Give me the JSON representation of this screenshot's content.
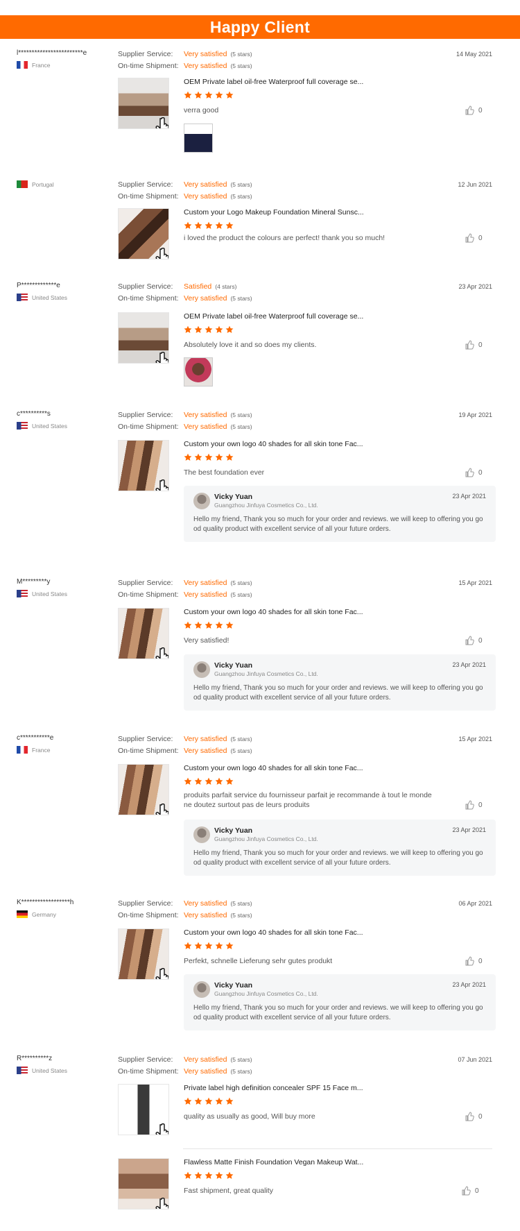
{
  "banner": {
    "title": "Happy Client"
  },
  "labels": {
    "supplier": "Supplier Service:",
    "shipment": "On-time Shipment:"
  },
  "reply": {
    "name": "Vicky Yuan",
    "company": "Guangzhou Jinfuya Cosmetics Co., Ltd.",
    "message": "Hello my friend, Thank you so much for your order and reviews. we will keep to offering you go od quality product with excellent service of all your future orders."
  },
  "colors": {
    "accent": "#ff6a00"
  },
  "reviews": [
    {
      "buyer": "l************************e",
      "country": "France",
      "date": "14 May 2021",
      "supplier": "Very satisfied",
      "supplier_stars": "(5 stars)",
      "shipment": "Very satisfied",
      "shipment_stars": "(5 stars)",
      "product": "OEM Private label oil-free Waterproof full coverage se...",
      "text": "verra good",
      "likes": "0",
      "rating": 5
    },
    {
      "buyer": "",
      "country": "Portugal",
      "date": "12 Jun 2021",
      "supplier": "Very satisfied",
      "supplier_stars": "(5 stars)",
      "shipment": "Very satisfied",
      "shipment_stars": "(5 stars)",
      "product": "Custom your Logo Makeup Foundation Mineral Sunsc...",
      "text": "i loved the product the colours are perfect! thank you so much!",
      "likes": "0",
      "rating": 5
    },
    {
      "buyer": "P*************e",
      "country": "United States",
      "date": "23 Apr 2021",
      "supplier": "Satisfied",
      "supplier_stars": "(4 stars)",
      "shipment": "Very satisfied",
      "shipment_stars": "(5 stars)",
      "product": "OEM Private label oil-free Waterproof full coverage se...",
      "text": "Absolutely love it and so does my clients.",
      "likes": "0",
      "rating": 5
    },
    {
      "buyer": "c**********s",
      "country": "United States",
      "date": "19 Apr 2021",
      "supplier": "Very satisfied",
      "supplier_stars": "(5 stars)",
      "shipment": "Very satisfied",
      "shipment_stars": "(5 stars)",
      "product": "Custom your own logo 40 shades for all skin tone Fac...",
      "text": "The best foundation ever",
      "likes": "0",
      "rating": 5,
      "reply_date": "23 Apr 2021"
    },
    {
      "buyer": "M*********y",
      "country": "United States",
      "date": "15 Apr 2021",
      "supplier": "Very satisfied",
      "supplier_stars": "(5 stars)",
      "shipment": "Very satisfied",
      "shipment_stars": "(5 stars)",
      "product": "Custom your own logo 40 shades for all skin tone Fac...",
      "text": "Very satisfied!",
      "likes": "0",
      "rating": 5,
      "reply_date": "23 Apr 2021"
    },
    {
      "buyer": "c***********e",
      "country": "France",
      "date": "15 Apr 2021",
      "supplier": "Very satisfied",
      "supplier_stars": "(5 stars)",
      "shipment": "Very satisfied",
      "shipment_stars": "(5 stars)",
      "product": "Custom your own logo 40 shades for all skin tone Fac...",
      "text": "produits parfait service du fournisseur parfait je recommande à tout le monde ne doutez surtout pas de leurs produits",
      "likes": "0",
      "rating": 5,
      "reply_date": "23 Apr 2021"
    },
    {
      "buyer": "K******************h",
      "country": "Germany",
      "date": "06 Apr 2021",
      "supplier": "Very satisfied",
      "supplier_stars": "(5 stars)",
      "shipment": "Very satisfied",
      "shipment_stars": "(5 stars)",
      "product": "Custom your own logo 40 shades for all skin tone Fac...",
      "text": "Perfekt, schnelle Lieferung sehr gutes produkt",
      "likes": "0",
      "rating": 5,
      "reply_date": "23 Apr 2021"
    },
    {
      "buyer": "R**********z",
      "country": "United States",
      "date": "07 Jun 2021",
      "supplier": "Very satisfied",
      "supplier_stars": "(5 stars)",
      "shipment": "Very satisfied",
      "shipment_stars": "(5 stars)",
      "product": "Private label high definition concealer SPF 15 Face m...",
      "text": "quality as usually as good, Will buy more",
      "likes": "0",
      "rating": 5,
      "product2": "Flawless Matte Finish Foundation Vegan Makeup Wat...",
      "text2": "Fast shipment, great quality",
      "likes2": "0",
      "rating2": 5
    }
  ]
}
